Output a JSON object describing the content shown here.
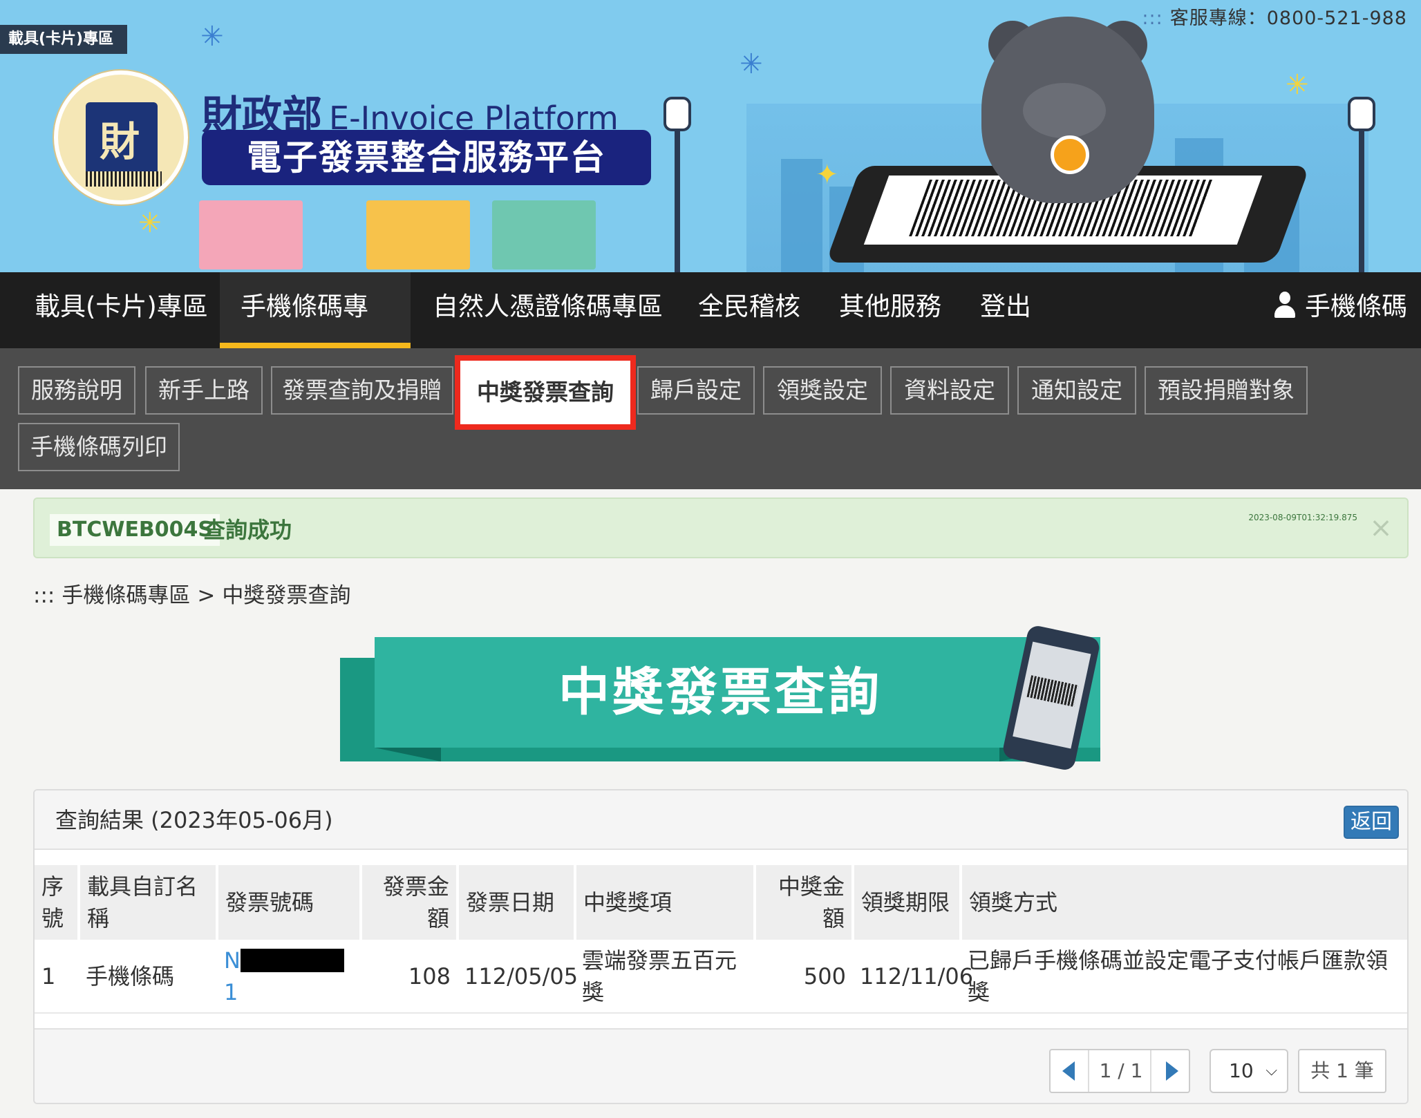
{
  "banner": {
    "tag": "載具(卡片)專區",
    "hotline": "客服專線：0800-521-988",
    "hotline_prefix": ":::",
    "title_cn": "財政部",
    "title_en": "E-Invoice Platform",
    "subtitle": "電子發票整合服務平台",
    "logo_char": "財"
  },
  "main_nav": {
    "items": [
      "載具(卡片)專區",
      "手機條碼專區",
      "自然人憑證條碼專區",
      "全民稽核",
      "其他服務",
      "登出"
    ],
    "active": "手機條碼專區",
    "user_label": "手機條碼"
  },
  "sub_nav": {
    "items": [
      "服務說明",
      "新手上路",
      "發票查詢及捐贈",
      "中獎發票查詢",
      "歸戶設定",
      "領獎設定",
      "資料設定",
      "通知設定",
      "預設捐贈對象",
      "手機條碼列印"
    ],
    "active": "中獎發票查詢"
  },
  "alert": {
    "code": "BTCWEB004S",
    "message": "查詢成功",
    "timestamp": "2023-08-09T01:32:19.875",
    "close": "×"
  },
  "breadcrumb": {
    "prefix": ":::",
    "parent": "手機條碼專區",
    "sep": ">",
    "current": "中獎發票查詢"
  },
  "page_title": "中獎發票查詢",
  "result": {
    "title": "查詢結果 (2023年05-06月)",
    "back_label": "返回",
    "columns": [
      "序號",
      "載具自訂名稱",
      "發票號碼",
      "發票金額",
      "發票日期",
      "中獎獎項",
      "中獎金額",
      "領獎期限",
      "領獎方式"
    ],
    "rows": [
      {
        "seq": "1",
        "carrier_name": "手機條碼",
        "invoice_prefix": "N",
        "invoice_suffix": "1",
        "amount": "108",
        "date": "112/05/05",
        "prize": "雲端發票五百元獎",
        "prize_amount": "500",
        "deadline": "112/11/06",
        "claim_method": "已歸戶手機條碼並設定電子支付帳戶匯款領獎"
      }
    ]
  },
  "pager": {
    "page_text": "1 / 1",
    "page_size": "10",
    "total_text": "共 1 筆"
  },
  "colors": {
    "nav_active_underline": "#f6b81c",
    "highlight_border": "#ee2a1e",
    "ribbon": "#2fb4a0",
    "primary_button": "#337ab7",
    "alert_bg": "#dff0d8"
  }
}
